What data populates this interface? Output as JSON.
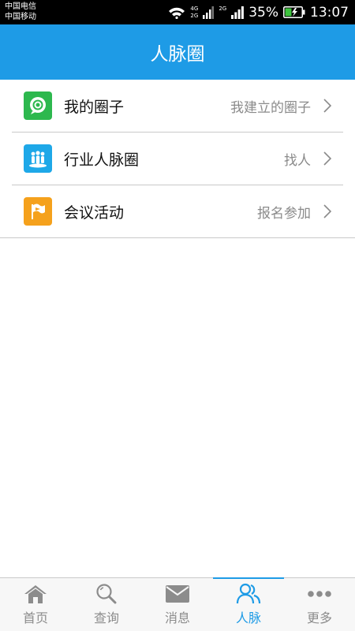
{
  "status_bar": {
    "carrier_1": "中国电信",
    "carrier_2": "中国移动",
    "net_1_top": "4G",
    "net_1_bottom": "2G",
    "net_2_top": "2G",
    "battery": "35%",
    "time": "13:07"
  },
  "header": {
    "title": "人脉圈"
  },
  "rows": [
    {
      "icon": "chat-bubble-icon",
      "color": "#2db84e",
      "title": "我的圈子",
      "subtitle": "我建立的圈子"
    },
    {
      "icon": "people-group-icon",
      "color": "#1ea8e8",
      "title": "行业人脉圈",
      "subtitle": "找人"
    },
    {
      "icon": "flag-icon",
      "color": "#f5a11c",
      "title": "会议活动",
      "subtitle": "报名参加"
    }
  ],
  "tabs": [
    {
      "icon": "home-icon",
      "label": "首页",
      "active": false
    },
    {
      "icon": "search-icon",
      "label": "查询",
      "active": false
    },
    {
      "icon": "mail-icon",
      "label": "消息",
      "active": false
    },
    {
      "icon": "contacts-icon",
      "label": "人脉",
      "active": true
    },
    {
      "icon": "more-icon",
      "label": "更多",
      "active": false
    }
  ],
  "colors": {
    "accent": "#1e9be6",
    "tab_inactive": "#8c8c8c"
  }
}
